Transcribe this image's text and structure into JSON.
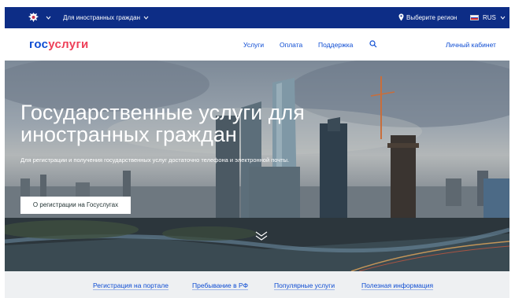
{
  "topbar": {
    "foreign_citizens": "Для иностранных граждан",
    "region": "Выберите регион",
    "language": "RUS"
  },
  "header": {
    "logo_part1": "гос",
    "logo_part2": "услуги",
    "nav": [
      "Услуги",
      "Оплата",
      "Поддержка"
    ],
    "account": "Личный кабинет"
  },
  "hero": {
    "title": "Государственные услуги для иностранных граждан",
    "subtitle": "Для регистрации и получения государственных услуг достаточно телефона и электронной почты.",
    "button": "О регистрации на Госуслугах"
  },
  "bottom_nav": [
    "Регистрация на портале",
    "Пребывание в РФ",
    "Популярные услуги",
    "Полезная информация"
  ],
  "colors": {
    "topbar": "#0d2d86",
    "accent": "#0d4cd3",
    "logo_red": "#ee3f58"
  }
}
